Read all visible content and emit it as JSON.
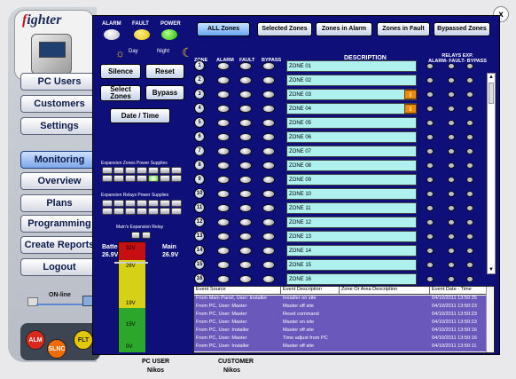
{
  "brand": {
    "name_red": "f",
    "name_rest": "ighter"
  },
  "sidebar": {
    "items": [
      {
        "label": "PC Users"
      },
      {
        "label": "Customers"
      },
      {
        "label": "Settings"
      },
      {
        "label": "Monitoring"
      },
      {
        "label": "Overview"
      },
      {
        "label": "Plans"
      },
      {
        "label": "Programming"
      },
      {
        "label": "Create Reports"
      },
      {
        "label": "Logout"
      }
    ],
    "online_label": "ON-line"
  },
  "status_buttons": {
    "alm": "ALM",
    "slnc": "SLNC",
    "flt": "FLT"
  },
  "panel": {
    "led_labels": [
      "ALARM",
      "FAULT",
      "POWER"
    ],
    "day_label": "Day",
    "night_label": "Night",
    "buttons": {
      "silence": "Silence",
      "reset": "Reset",
      "select": "Select Zones",
      "bypass": "Bypass",
      "datetime": "Date / Time"
    },
    "expansion_zones_label": "Expansion Zones Power Supplies",
    "expansion_relays_label": "Expansion Relays Power Supplies",
    "main_relay_label": "Main's Expansion Relay",
    "battery_label": "Battery",
    "battery_value": "26.9V",
    "main_label": "Main",
    "main_value": "26.9V",
    "gauge_levels": [
      "32V",
      "26V",
      "19V",
      "15V",
      "0V"
    ]
  },
  "zone_filters": [
    "ALL Zones",
    "Selected Zones",
    "Zones in Alarm",
    "Zones in Fault",
    "Bypassed Zones"
  ],
  "zone_headers": {
    "zone": "ZONE",
    "alarm": "ALARM",
    "fault": "FAULT",
    "bypass": "BYPASS",
    "description": "DESCRIPTION",
    "relays": "RELAYS EXP.",
    "relay_cols": "ALARM- FAULT- BYPASS"
  },
  "zones": [
    {
      "num": "1",
      "desc": "ZONE 01",
      "info": false
    },
    {
      "num": "2",
      "desc": "ZONE 02",
      "info": false
    },
    {
      "num": "3",
      "desc": "ZONE 03",
      "info": true
    },
    {
      "num": "4",
      "desc": "ZONE 04",
      "info": true
    },
    {
      "num": "5",
      "desc": "ZONE 05",
      "info": false
    },
    {
      "num": "6",
      "desc": "ZONE 06",
      "info": false
    },
    {
      "num": "7",
      "desc": "ZONE 07",
      "info": false
    },
    {
      "num": "8",
      "desc": "ZONE 08",
      "info": false
    },
    {
      "num": "9",
      "desc": "ZONE 09",
      "info": false
    },
    {
      "num": "10",
      "desc": "ZONE 10",
      "info": false
    },
    {
      "num": "11",
      "desc": "ZONE 11",
      "info": false
    },
    {
      "num": "12",
      "desc": "ZONE 12",
      "info": false
    },
    {
      "num": "13",
      "desc": "ZONE 13",
      "info": false
    },
    {
      "num": "14",
      "desc": "ZONE 14",
      "info": false
    },
    {
      "num": "15",
      "desc": "ZONE 15",
      "info": false
    },
    {
      "num": "16",
      "desc": "ZONE 16",
      "info": false
    }
  ],
  "events": {
    "headers": [
      "Event Source",
      "Event Description",
      "Zone Or Area Description",
      "Event Date - Time"
    ],
    "rows": [
      [
        "From Main Panel, User: Installer",
        "Installer on site",
        "",
        "04/10/2011 13:50:35"
      ],
      [
        "From PC, User: Master",
        "Master off site",
        "",
        "04/10/2011 13:50:23"
      ],
      [
        "From PC, User: Master",
        "Reset command",
        "",
        "04/10/2011 13:50:23"
      ],
      [
        "From PC, User: Master",
        "Master on site",
        "",
        "04/10/2011 13:50:23"
      ],
      [
        "From PC, User: Installer",
        "Master off site",
        "",
        "04/10/2011 13:50:16"
      ],
      [
        "From PC, User: Master",
        "Time adjust from PC",
        "",
        "04/10/2011 13:50:16"
      ],
      [
        "From PC, User: Installer",
        "Master off site",
        "",
        "04/10/2011 13:50:11"
      ]
    ]
  },
  "footer": {
    "pc_user_label": "PC USER",
    "pc_user_name": "Nikos",
    "customer_label": "CUSTOMER",
    "customer_name": "Nikos"
  },
  "close": "x"
}
